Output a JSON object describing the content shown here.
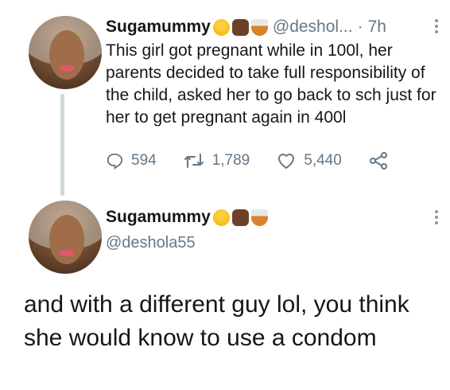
{
  "tweet1": {
    "display_name": "Sugamummy",
    "handle": "@deshol...",
    "separator": "·",
    "time": "7h",
    "text": "This girl got pregnant while in 100l, her parents decided to take full responsibility of the child, asked her to go back to sch just for her to get pregnant again in 400l",
    "replies": "594",
    "retweets": "1,789",
    "likes": "5,440",
    "icons": [
      "reply-icon",
      "retweet-icon",
      "like-icon",
      "share-icon"
    ]
  },
  "tweet2": {
    "display_name": "Sugamummy",
    "handle": "@deshola55",
    "text": "and with a different guy lol, you think she would know to use a condom"
  },
  "colors": {
    "text": "#14171a",
    "secondary": "#657786",
    "thread_line": "#cfd9de"
  }
}
